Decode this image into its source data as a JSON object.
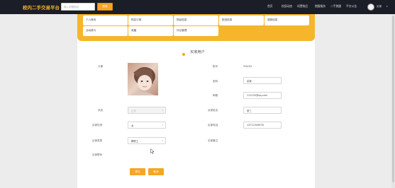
{
  "header": {
    "site_title": "校内二手交易平台",
    "search": {
      "placeholder": "输入闲置物品",
      "button_label": "搜索"
    },
    "nav": [
      "首页",
      "校园动态",
      "闲置物品",
      "跑腿服务",
      "二手跑腿",
      "平台公告"
    ],
    "user": {
      "name": "买家"
    }
  },
  "menu": {
    "items": [
      "个人首页",
      "购买订单",
      "物品信息",
      "配送信息",
      "退款信息",
      "活动参与",
      "收藏",
      "评论管理"
    ]
  },
  "form": {
    "section_title": "买家用户",
    "labels": {
      "avatar": "头像",
      "account": "账号",
      "password": "密码",
      "email": "邮箱",
      "status": "状态",
      "buyer_name": "买家姓名",
      "gender": "买家性别",
      "phone": "买家电话",
      "type": "买家类型",
      "remark": "买家备注",
      "contact": "买家联系"
    },
    "values": {
      "account": "YG233",
      "password": "买家",
      "email": "112233@qq.com",
      "status": "正常",
      "buyer_name": "张三",
      "gender": "女",
      "phone": "13712345678",
      "type": "教职工"
    },
    "buttons": {
      "submit": "提交",
      "cancel": "取消"
    }
  },
  "colors": {
    "accent": "#f5a623",
    "topbar": "#1b1d27"
  }
}
